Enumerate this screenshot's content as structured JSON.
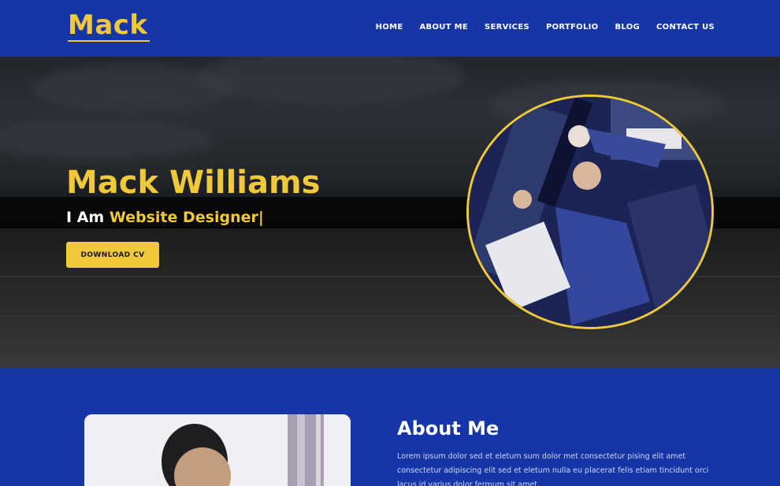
{
  "brand": {
    "logo": "Mack"
  },
  "nav": {
    "items": [
      "HOME",
      "ABOUT ME",
      "SERVICES",
      "PORTFOLIO",
      "BLOG",
      "CONTACT US"
    ]
  },
  "hero": {
    "name": "Mack Williams",
    "intro": "I Am ",
    "role": "Website Designer|",
    "cta": "DOWNLOAD CV"
  },
  "about": {
    "title": "About Me",
    "text": "Lorem ipsum dolor sed et eletum sum dolor met consectetur pising elit amet consectetur adipiscing elit sed et eletum nulla eu placerat felis etiam tincidunt orci lacus id varius dolor fermum sit amet."
  },
  "colors": {
    "primary": "#1636a8",
    "accent": "#f0c93a",
    "text_light": "#ffffff"
  }
}
